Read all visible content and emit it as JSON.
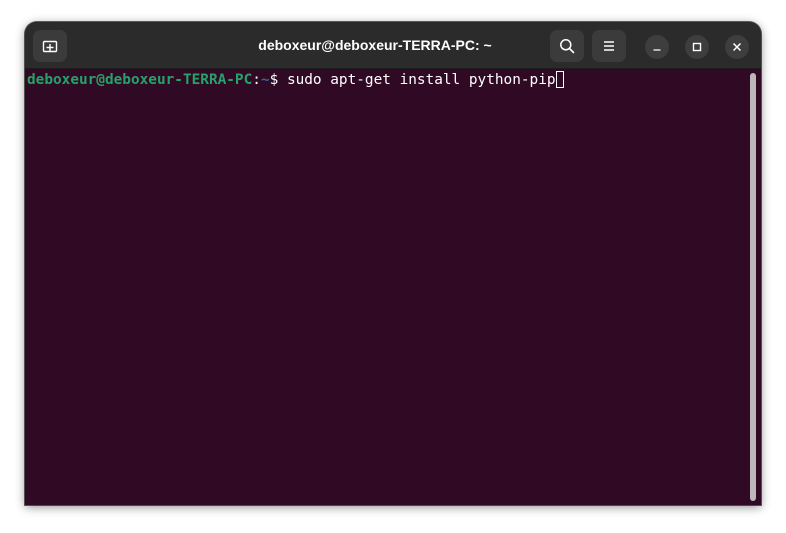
{
  "window": {
    "title": "deboxeur@deboxeur-TERRA-PC: ~"
  },
  "headerbar": {
    "new_tab_icon": "new-tab-icon",
    "search_icon": "search-icon",
    "menu_icon": "hamburger-menu-icon",
    "minimize_icon": "minimize-icon",
    "maximize_icon": "maximize-icon",
    "close_icon": "close-icon"
  },
  "terminal": {
    "prompt_user_host": "deboxeur@deboxeur-TERRA-PC",
    "prompt_separator": ":",
    "prompt_path": "~",
    "prompt_symbol": "$ ",
    "command": "sudo apt-get install python-pip"
  },
  "colors": {
    "terminal_background": "#300a24",
    "prompt_user_color": "#26a269",
    "prompt_path_color": "#3465a4",
    "headerbar_background": "#2b2b2b"
  }
}
